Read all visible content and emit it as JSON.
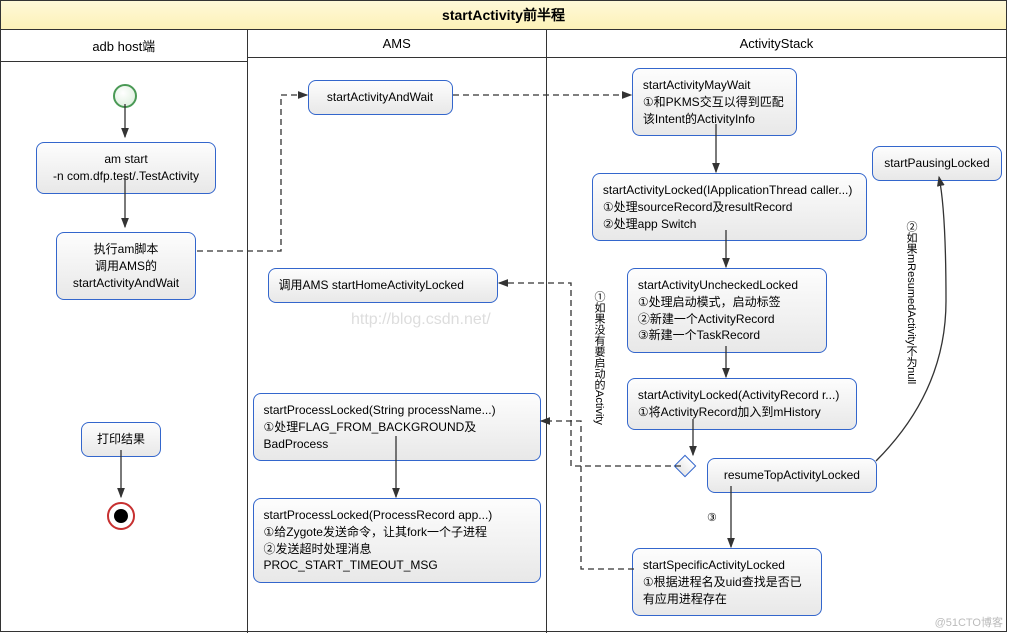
{
  "title": "startActivity前半程",
  "lanes": {
    "lane1": {
      "header": "adb host端"
    },
    "lane2": {
      "header": "AMS"
    },
    "lane3": {
      "header": "ActivityStack"
    }
  },
  "nodes": {
    "amStart": "am start\n-n com.dfp.test/.TestActivity",
    "execScript": "执行am脚本\n调用AMS的\nstartActivityAndWait",
    "printResult": "打印结果",
    "startActivityAndWait": "startActivityAndWait",
    "callHomeLocked": "调用AMS startHomeActivityLocked",
    "startProcessLocked1": "startProcessLocked(String processName...)\n①处理FLAG_FROM_BACKGROUND及BadProcess",
    "startProcessLocked2": "startProcessLocked(ProcessRecord app...)\n①给Zygote发送命令，让其fork一个子进程\n②发送超时处理消息PROC_START_TIMEOUT_MSG",
    "mayWait": "startActivityMayWait\n①和PKMS交互以得到匹配\n该Intent的ActivityInfo",
    "startActivityLocked1": "startActivityLocked(IApplicationThread caller...)\n①处理sourceRecord及resultRecord\n②处理app Switch",
    "uncheckedLocked": "startActivityUncheckedLocked\n①处理启动模式，启动标签\n②新建一个ActivityRecord\n③新建一个TaskRecord",
    "startActivityLocked2": "startActivityLocked(ActivityRecord r...)\n①将ActivityRecord加入到mHistory",
    "resumeTop": "resumeTopActivityLocked",
    "startSpecific": "startSpecificActivityLocked\n①根据进程名及uid查找是否已\n有应用进程存在",
    "startPausing": "startPausingLocked"
  },
  "arrowLabels": {
    "noActivity": "①如果没有要启动的Activity",
    "resumedNotNull": "②如果mResumedActivity不为null",
    "three": "③"
  },
  "watermark": "http://blog.csdn.net/",
  "attribution": "@51CTO博客"
}
